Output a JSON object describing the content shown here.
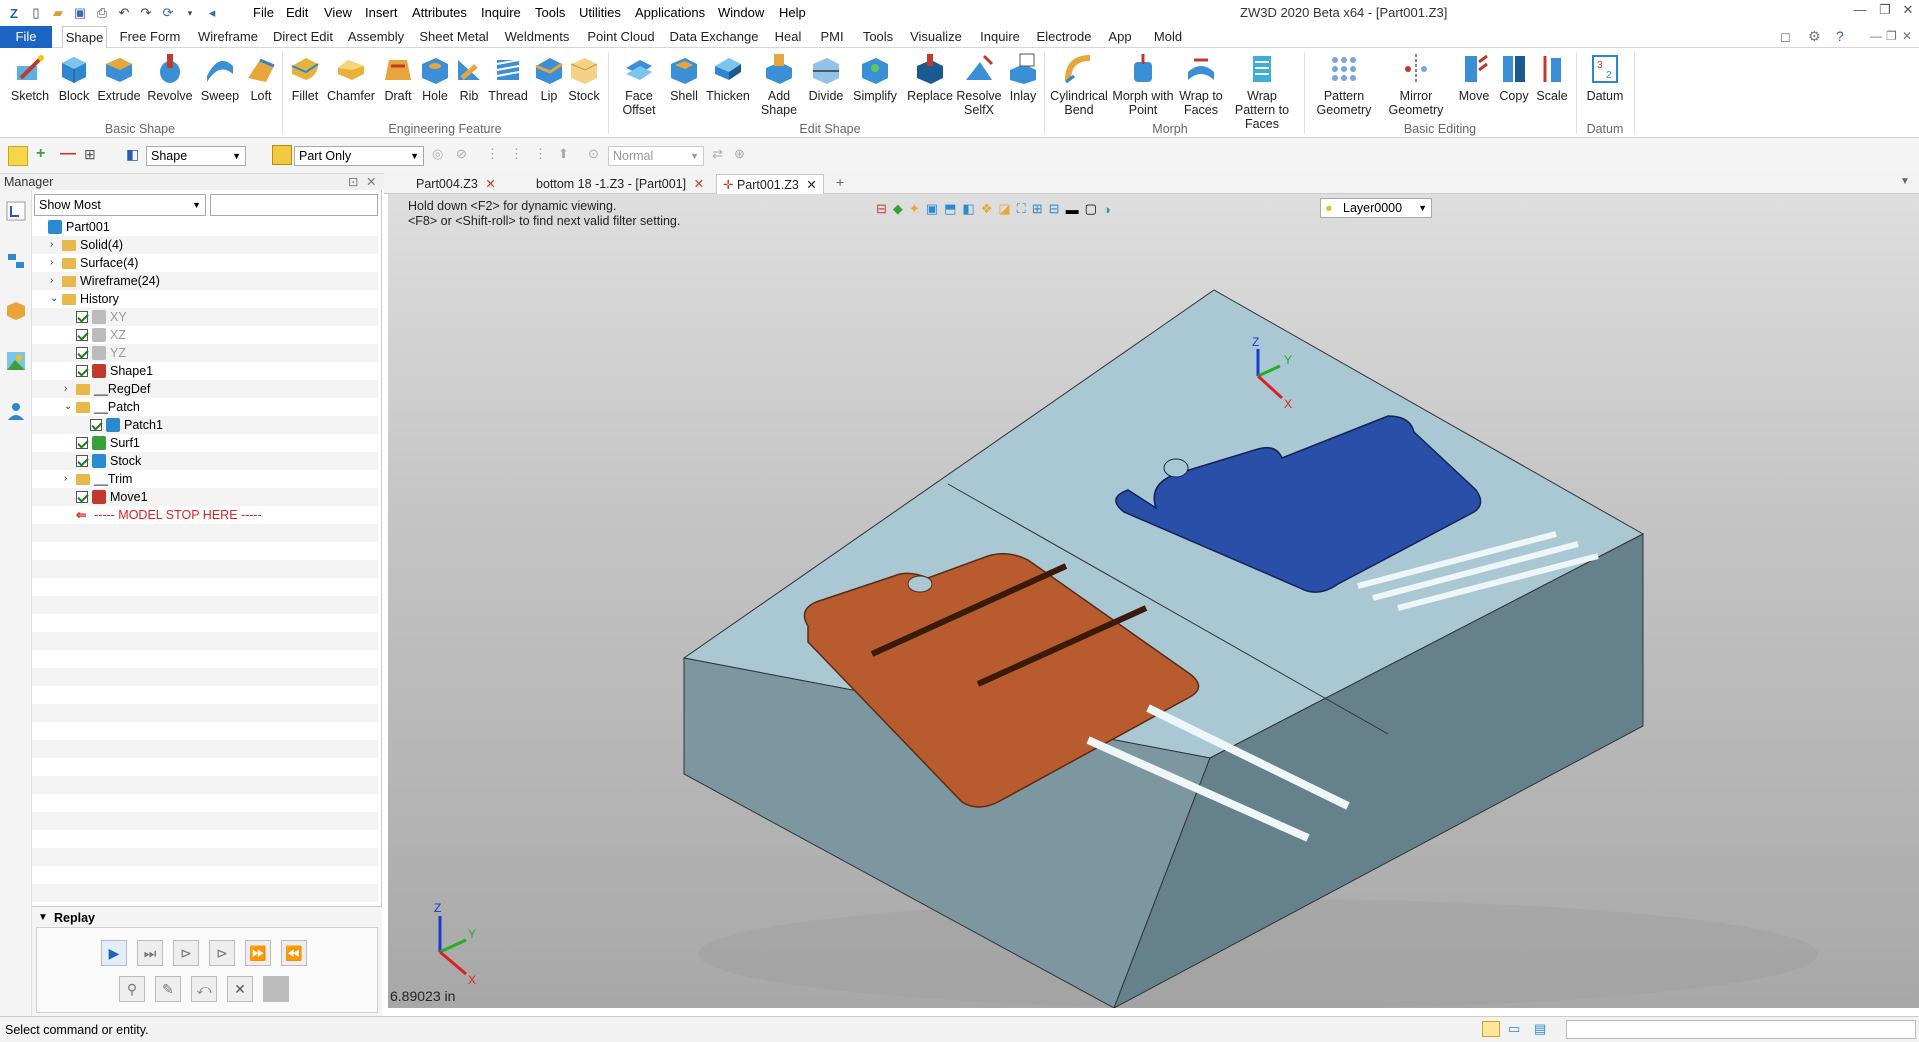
{
  "title": "ZW3D 2020 Beta x64 - [Part001.Z3]",
  "menu": [
    "File",
    "Edit",
    "View",
    "Insert",
    "Attributes",
    "Inquire",
    "Tools",
    "Utilities",
    "Applications",
    "Window",
    "Help"
  ],
  "ribbon_tabs": [
    "File",
    "Shape",
    "Free Form",
    "Wireframe",
    "Direct Edit",
    "Assembly",
    "Sheet Metal",
    "Weldments",
    "Point Cloud",
    "Data Exchange",
    "Heal",
    "PMI",
    "Tools",
    "Visualize",
    "Inquire",
    "Electrode",
    "App",
    "Mold"
  ],
  "ribbon": {
    "basic_shape": {
      "label": "Basic Shape",
      "items": [
        "Sketch",
        "Block",
        "Extrude",
        "Revolve",
        "Sweep",
        "Loft"
      ]
    },
    "engineering": {
      "label": "Engineering Feature",
      "items": [
        "Fillet",
        "Chamfer",
        "Draft",
        "Hole",
        "Rib",
        "Thread",
        "Lip",
        "Stock"
      ]
    },
    "edit_shape": {
      "label": "Edit Shape",
      "items": [
        "Face Offset",
        "Shell",
        "Thicken",
        "Add Shape",
        "Divide",
        "Simplify",
        "Replace",
        "Resolve SelfX",
        "Inlay"
      ]
    },
    "morph": {
      "label": "Morph",
      "items": [
        "Cylindrical Bend",
        "Morph with Point",
        "Wrap to Faces",
        "Wrap Pattern to Faces"
      ]
    },
    "basic_editing": {
      "label": "Basic Editing",
      "items": [
        "Pattern Geometry",
        "Mirror Geometry",
        "Move",
        "Copy",
        "Scale"
      ]
    },
    "datum": {
      "label": "Datum",
      "items": [
        "Datum"
      ]
    }
  },
  "filter": {
    "shape": "Shape",
    "scope": "Part Only",
    "mode": "Normal"
  },
  "manager": {
    "title": "Manager",
    "show": "Show Most",
    "tree": [
      {
        "label": "Part001",
        "level": 0,
        "exp": "",
        "chk": false,
        "ic": "part"
      },
      {
        "label": "Solid(4)",
        "level": 1,
        "exp": ">",
        "chk": false,
        "ic": "folder"
      },
      {
        "label": "Surface(4)",
        "level": 1,
        "exp": ">",
        "chk": false,
        "ic": "folder"
      },
      {
        "label": "Wireframe(24)",
        "level": 1,
        "exp": ">",
        "chk": false,
        "ic": "folder"
      },
      {
        "label": "History",
        "level": 1,
        "exp": "v",
        "chk": false,
        "ic": "folder"
      },
      {
        "label": "XY",
        "level": 2,
        "exp": "",
        "chk": true,
        "ic": "plane",
        "grey": true
      },
      {
        "label": "XZ",
        "level": 2,
        "exp": "",
        "chk": true,
        "ic": "plane",
        "grey": true
      },
      {
        "label": "YZ",
        "level": 2,
        "exp": "",
        "chk": true,
        "ic": "plane",
        "grey": true
      },
      {
        "label": "Shape1",
        "level": 2,
        "exp": "",
        "chk": true,
        "ic": "shape"
      },
      {
        "label": "__RegDef",
        "level": 2,
        "exp": ">",
        "chk": false,
        "ic": "folder"
      },
      {
        "label": "__Patch",
        "level": 2,
        "exp": "v",
        "chk": false,
        "ic": "folder"
      },
      {
        "label": "Patch1",
        "level": 3,
        "exp": "",
        "chk": true,
        "ic": "patch"
      },
      {
        "label": "Surf1",
        "level": 2,
        "exp": "",
        "chk": true,
        "ic": "surf"
      },
      {
        "label": "Stock",
        "level": 2,
        "exp": "",
        "chk": true,
        "ic": "stock"
      },
      {
        "label": "__Trim",
        "level": 2,
        "exp": ">",
        "chk": false,
        "ic": "folder"
      },
      {
        "label": "Move1",
        "level": 2,
        "exp": "",
        "chk": true,
        "ic": "move"
      },
      {
        "label": "----- MODEL STOP HERE -----",
        "level": 2,
        "exp": "",
        "chk": false,
        "ic": "stop",
        "red": true
      }
    ],
    "replay_title": "Replay"
  },
  "doc_tabs": [
    "Part004.Z3",
    "bottom 18 -1.Z3 - [Part001]",
    "Part001.Z3"
  ],
  "viewport": {
    "hint1": "Hold down <F2> for dynamic viewing.",
    "hint2": "<F8> or <Shift-roll> to find next valid filter setting.",
    "layer": "Layer0000",
    "measure": "6.89023 in"
  },
  "status": "Select command or entity.",
  "colors": {
    "accent": "#1c64c4",
    "blue_part": "#2a4fa8",
    "orange_part": "#b85c30",
    "block": "#a9c8d4"
  }
}
